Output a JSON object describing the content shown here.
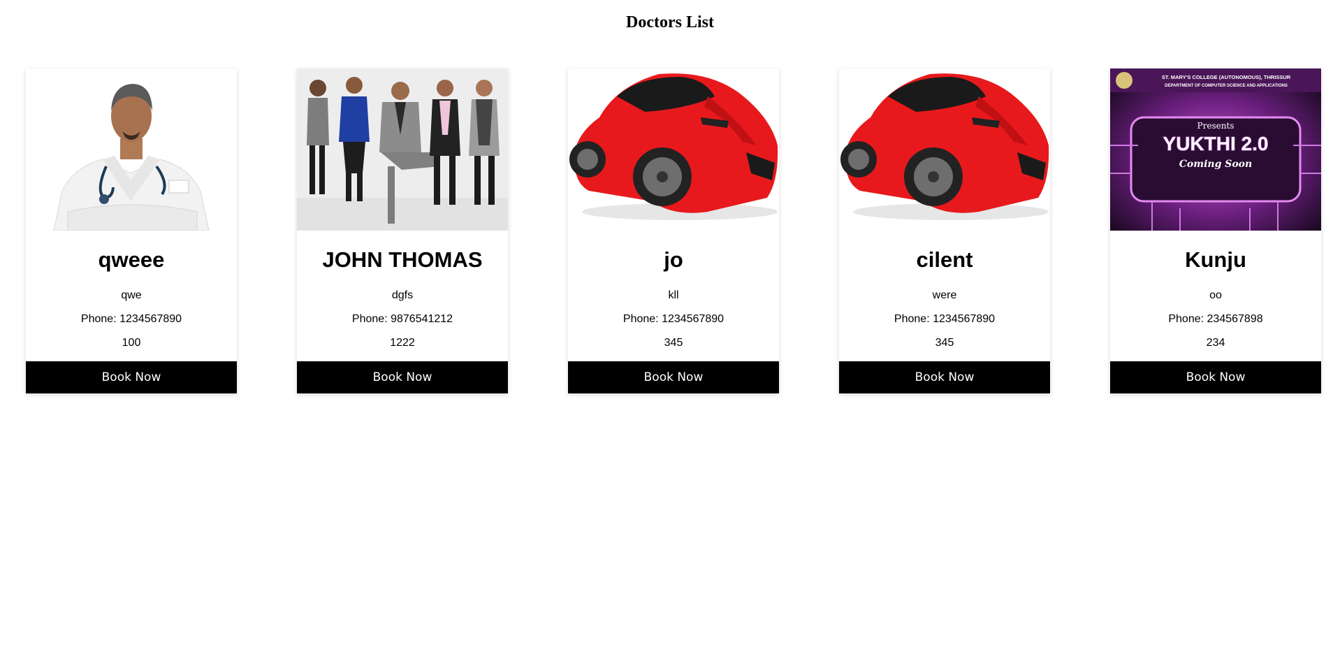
{
  "page": {
    "title": "Doctors List"
  },
  "doctors": [
    {
      "name": "qweee",
      "specialization": "qwe",
      "phone_label": "Phone:",
      "phone": "1234567890",
      "fee": "100",
      "button_label": "Book Now",
      "image": "doctor-portrait-photo"
    },
    {
      "name": "JOHN THOMAS",
      "specialization": "dgfs",
      "phone_label": "Phone:",
      "phone": "9876541212",
      "fee": "1222",
      "button_label": "Book Now",
      "image": "group-team-photo"
    },
    {
      "name": "jo",
      "specialization": "kll",
      "phone_label": "Phone:",
      "phone": "1234567890",
      "fee": "345",
      "button_label": "Book Now",
      "image": "red-sports-car-photo"
    },
    {
      "name": "cilent",
      "specialization": "were",
      "phone_label": "Phone:",
      "phone": "1234567890",
      "fee": "345",
      "button_label": "Book Now",
      "image": "red-sports-car-photo"
    },
    {
      "name": "Kunju",
      "specialization": "oo",
      "phone_label": "Phone:",
      "phone": "234567898",
      "fee": "234",
      "button_label": "Book Now",
      "image": "event-poster-image",
      "poster": {
        "header_line1": "ST. MARY'S COLLEGE (AUTONOMOUS), THRISSUR",
        "header_line2": "DEPARTMENT OF COMPUTER SCIENCE AND APPLICATIONS",
        "presents": "Presents",
        "event": "YUKTHI 2.0",
        "tagline": "Coming Soon"
      }
    }
  ],
  "colors": {
    "button_bg": "#000000",
    "button_text": "#ffffff",
    "car_red": "#e8191c",
    "poster_purple": "#7a2a8c"
  }
}
